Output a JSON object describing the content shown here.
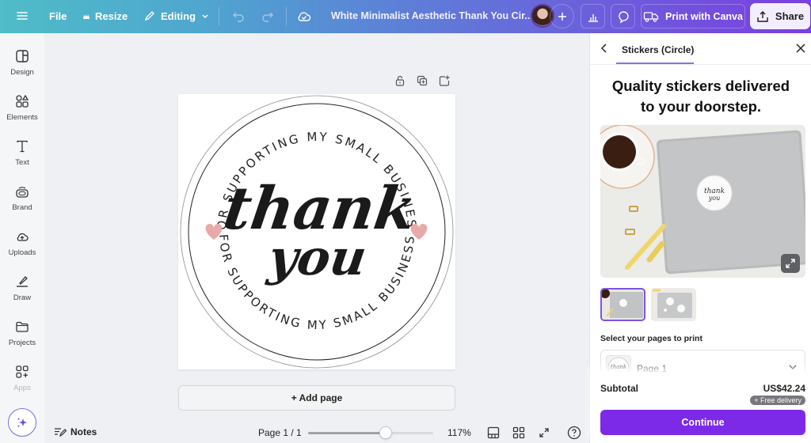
{
  "topbar": {
    "menu_icon": "hamburger-icon",
    "file_label": "File",
    "resize_label": "Resize",
    "editing_label": "Editing",
    "design_title": "White Minimalist Aesthetic Thank You Cir...",
    "print_label": "Print with Canva",
    "share_label": "Share"
  },
  "sidebar": {
    "items": [
      {
        "label": "Design",
        "icon": "layout-icon"
      },
      {
        "label": "Elements",
        "icon": "shapes-icon"
      },
      {
        "label": "Text",
        "icon": "text-icon"
      },
      {
        "label": "Brand",
        "icon": "brand-icon"
      },
      {
        "label": "Uploads",
        "icon": "cloud-upload-icon"
      },
      {
        "label": "Draw",
        "icon": "pen-icon"
      },
      {
        "label": "Projects",
        "icon": "folder-icon"
      },
      {
        "label": "Apps",
        "icon": "apps-icon"
      }
    ]
  },
  "canvas": {
    "arc_text": "FOR SUPPORTING MY SMALL BUSINESS",
    "script_line1": "thank",
    "script_line2": "you",
    "heart_color": "#e8aaa8",
    "add_page_label": "+ Add page"
  },
  "bottombar": {
    "notes_label": "Notes",
    "page_indicator": "Page 1 / 1",
    "zoom_level": "117%",
    "zoom_slider_fraction": 0.62
  },
  "panel": {
    "tab_label": "Stickers (Circle)",
    "headline_line1": "Quality stickers delivered",
    "headline_line2": "to your doorstep.",
    "select_pages_label": "Select your pages to print",
    "page_option": "Page 1",
    "subtotal_label": "Subtotal",
    "subtotal_value": "US$42.24",
    "free_delivery": "+ Free delivery",
    "continue_label": "Continue",
    "accent_color": "#7d2ae8"
  }
}
